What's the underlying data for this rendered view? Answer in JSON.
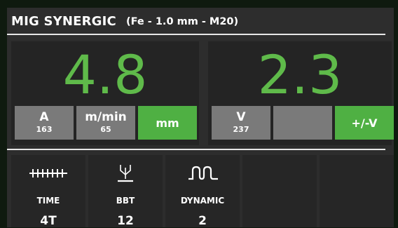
{
  "header": {
    "title": "MIG SYNERGIC",
    "subtitle": "(Fe - 1.0 mm - M20)"
  },
  "left_panel": {
    "value": "4.8",
    "buttons": [
      {
        "main": "A",
        "sub": "163",
        "state": "inactive"
      },
      {
        "main": "m/min",
        "sub": "65",
        "state": "inactive"
      },
      {
        "main": "mm",
        "state": "active"
      }
    ]
  },
  "right_panel": {
    "value": "2.3",
    "buttons": [
      {
        "main": "V",
        "sub": "237",
        "state": "inactive"
      },
      {
        "main": "",
        "state": "inactive"
      },
      {
        "main": "+/-V",
        "state": "active"
      }
    ]
  },
  "settings": [
    {
      "icon": "pulse-train-icon",
      "label": "TIME",
      "value": "4T"
    },
    {
      "icon": "wire-stickout-icon",
      "label": "BBT",
      "value": "12"
    },
    {
      "icon": "dynamic-wave-icon",
      "label": "DYNAMIC",
      "value": "2"
    }
  ],
  "colors": {
    "accent_green": "#4fb043",
    "value_green": "#5fba4a",
    "button_grey": "#7a7a7a",
    "panel": "#242424",
    "background": "#2d2d2d"
  }
}
